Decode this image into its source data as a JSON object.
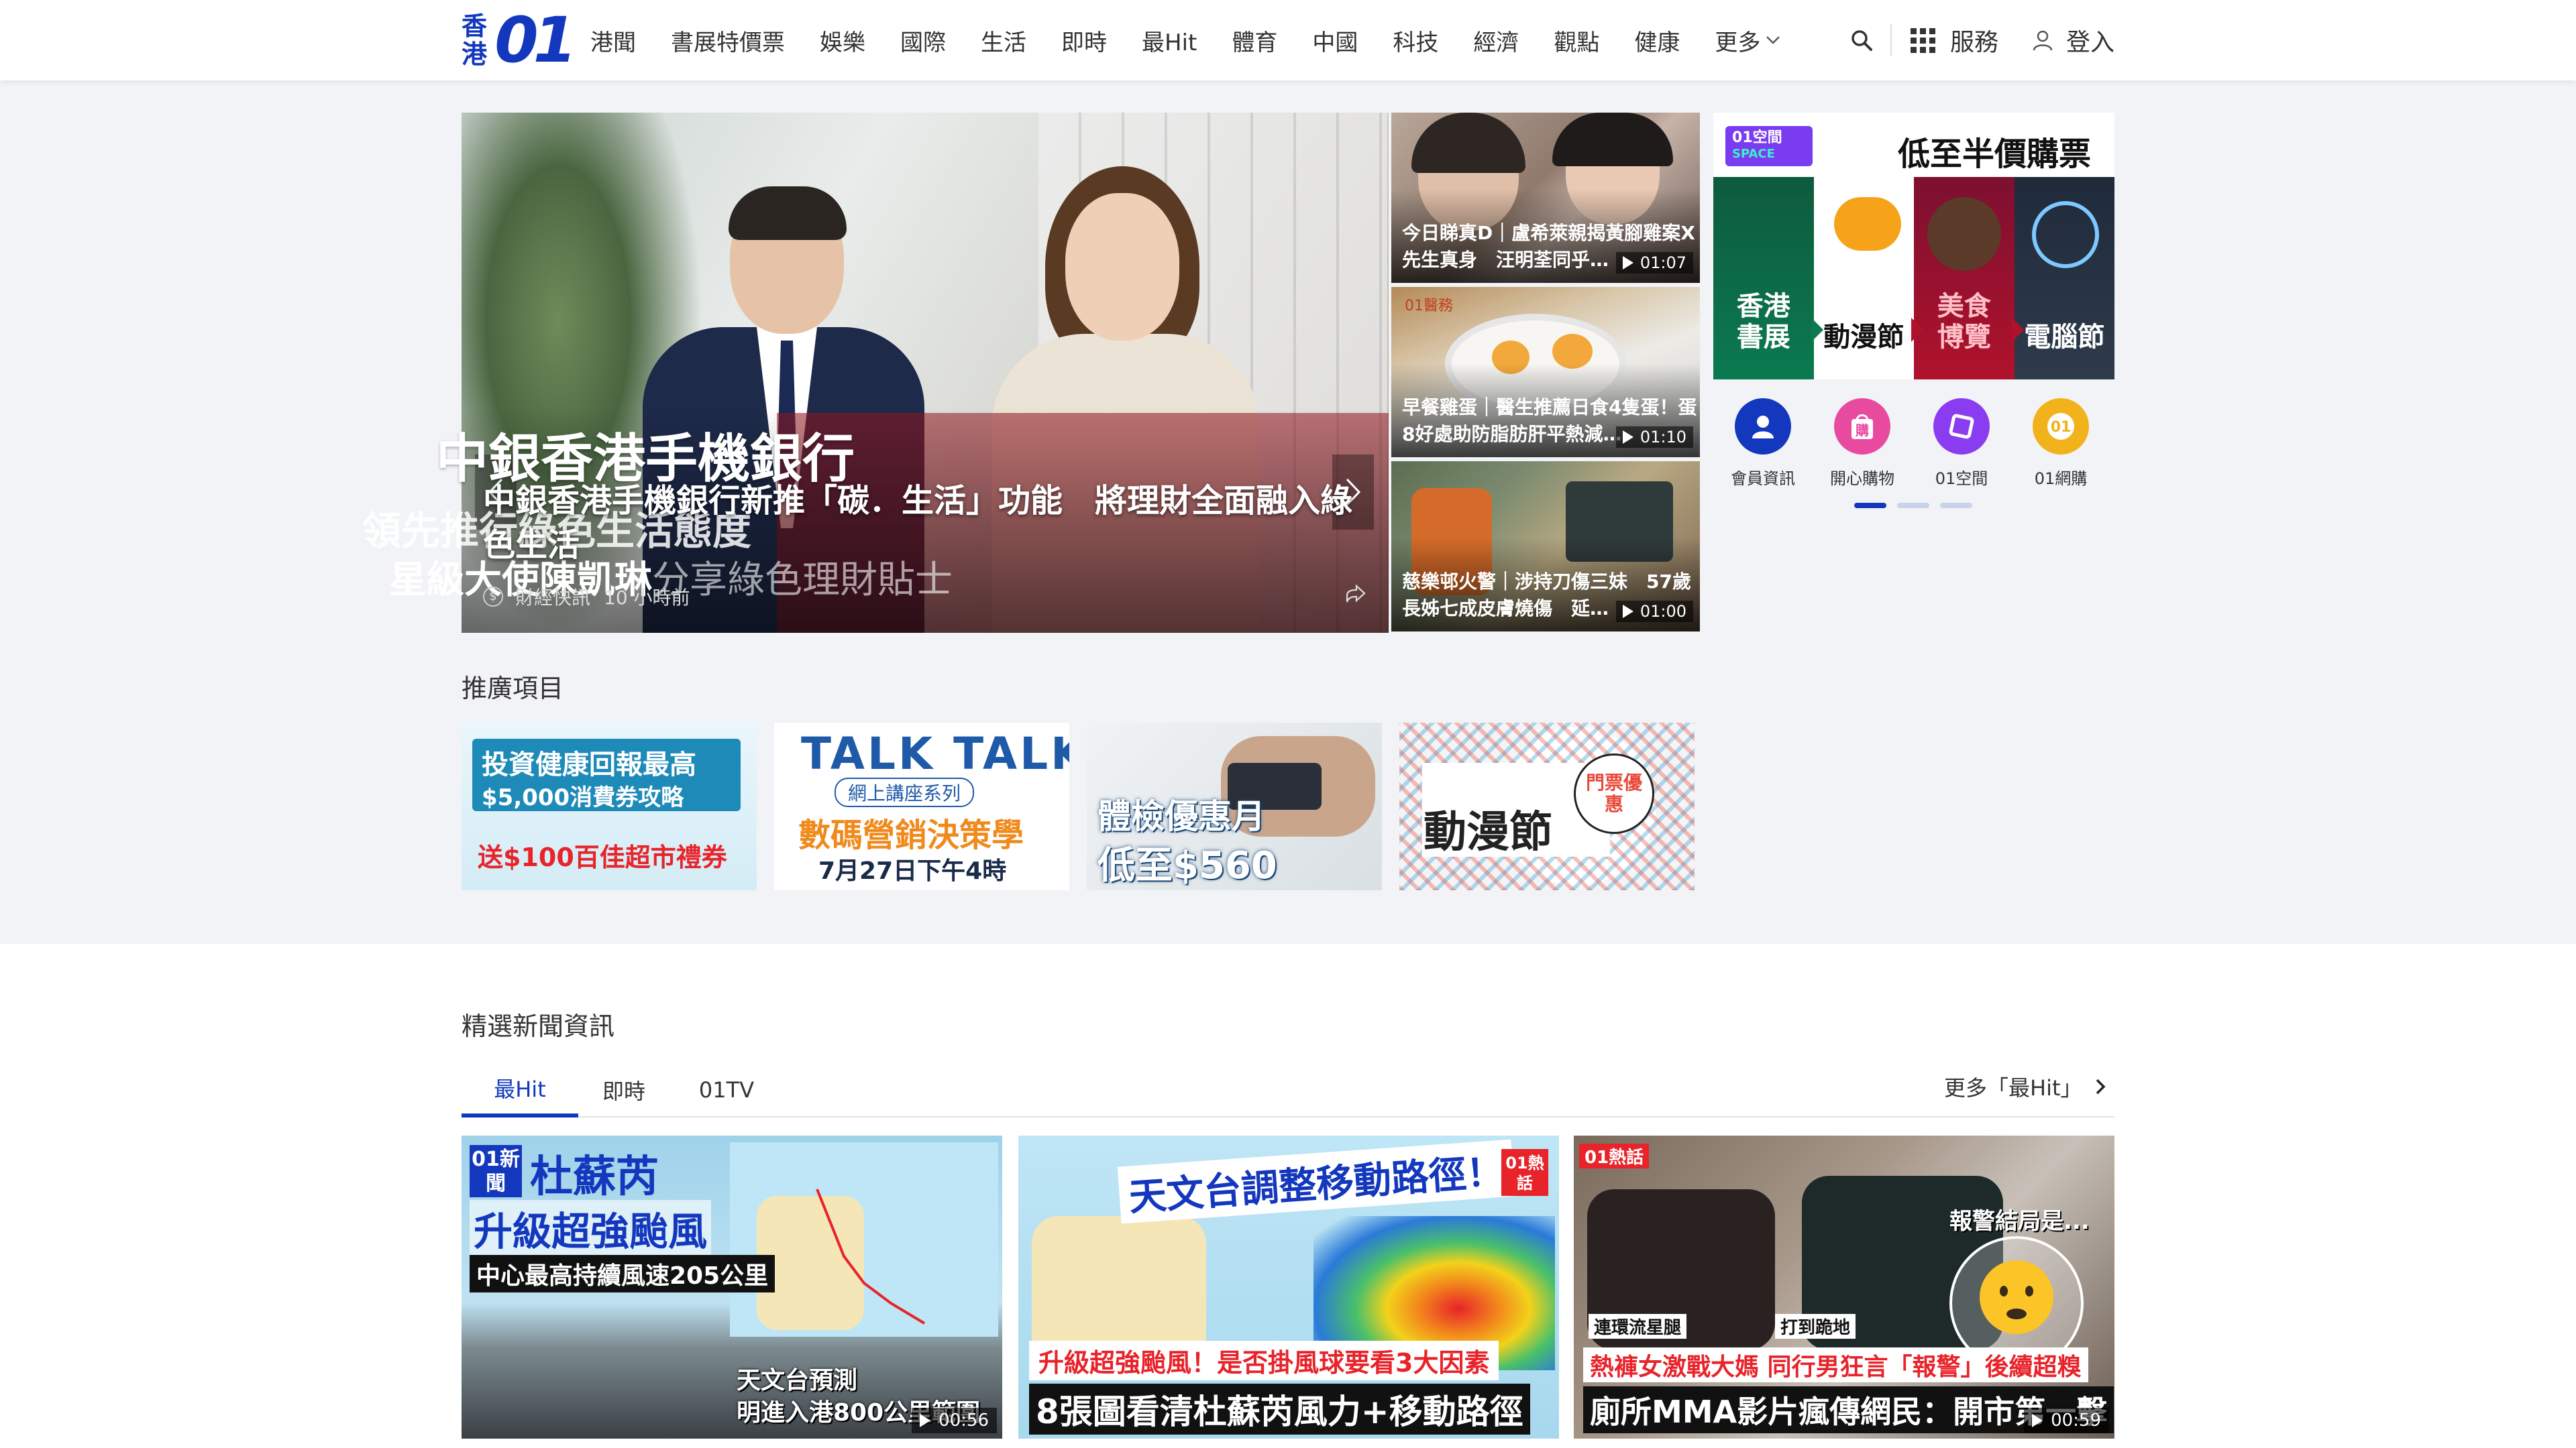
{
  "header": {
    "logo_cn_top": "香",
    "logo_cn_bottom": "港",
    "logo_mark": "01",
    "nav": [
      "港聞",
      "書展特價票",
      "娛樂",
      "國際",
      "生活",
      "即時",
      "最Hit",
      "體育",
      "中國",
      "科技",
      "經濟",
      "觀點",
      "健康"
    ],
    "more_label": "更多",
    "services_label": "服務",
    "login_label": "登入",
    "brand_color": "#1338be"
  },
  "hero": {
    "title": "中銀香港手機銀行新推「碳．生活」功能　將理財全面融入綠色生活",
    "category": "財經快訊",
    "time": "10 小時前",
    "banner_line1": "中銀香港手機銀行",
    "banner_line2": "領先推行綠色生活態度",
    "banner_line3_main": "星級大使陳凱琳",
    "banner_line3_sub": "分享綠色理財貼士"
  },
  "side_videos": [
    {
      "title": "今日睇真D｜盧希萊親揭黃腳雞案X先生真身　汪明荃同乎…",
      "duration": "01:07"
    },
    {
      "title": "早餐雞蛋｜醫生推薦日食4隻蛋！蛋8好處助防脂肪肝平熱減…",
      "duration": "01:10"
    },
    {
      "title": "慈樂邨火警｜涉持刀傷三妹　57歲長姊七成皮膚燒傷　延…",
      "duration": "01:00"
    }
  ],
  "promo_box": {
    "logo_line1": "01空間",
    "logo_line2": "SPACE",
    "title": "低至半價購票",
    "panels": [
      "香港\n書展",
      "動漫節",
      "美食\n博覽",
      "電腦節"
    ]
  },
  "services": [
    {
      "label": "會員資訊",
      "icon": "member-icon",
      "color": "#1338be"
    },
    {
      "label": "開心購物",
      "icon": "shopping-bag-icon",
      "color": "#e84aa0"
    },
    {
      "label": "01空間",
      "icon": "space-icon",
      "color": "#8a3df0"
    },
    {
      "label": "01網購",
      "icon": "01-shop-icon",
      "color": "#f2b21b"
    }
  ],
  "promotions": {
    "heading": "推廣項目",
    "ads": [
      {
        "line1": "投資健康回報最高",
        "line2": "$5,000消費券攻略",
        "line3": "送$100百佳超市禮券"
      },
      {
        "line1": "TALK TALK",
        "line2": "網上講座系列",
        "line3": "數碼營銷決策學",
        "line4": "7月27日下午4時"
      },
      {
        "line1": "體檢優惠月",
        "line2": "低至$560"
      },
      {
        "line1": "動漫節",
        "line2": "門票優惠"
      }
    ]
  },
  "news": {
    "heading": "精選新聞資訊",
    "tabs": [
      "最Hit",
      "即時",
      "01TV"
    ],
    "more_label": "更多「最Hit」",
    "cards": [
      {
        "tag": "01新聞",
        "headline1": "杜蘇芮",
        "headline2": "升級超強颱風",
        "headline3": "中心最高持續風速205公里",
        "caption1": "天文台預測",
        "caption2": "明進入港800公里範圍",
        "duration": "00:56"
      },
      {
        "tag": "01熱話",
        "headline1": "天文台調整移動路徑！",
        "headline2": "升級超強颱風！是否掛風球要看3大因素",
        "headline3": "8張圖看清杜蘇芮風力+移動路徑",
        "duration": ""
      },
      {
        "tag": "01熱話",
        "label1": "連環流星腿",
        "label2": "打到跪地",
        "bubble": "報警結局是...",
        "headline2": "熱褲女激戰大媽 同行男狂言「報警」後續超糗",
        "headline3": "廁所MMA影片瘋傳網民：開市第一擊",
        "duration": "00:59"
      }
    ]
  }
}
